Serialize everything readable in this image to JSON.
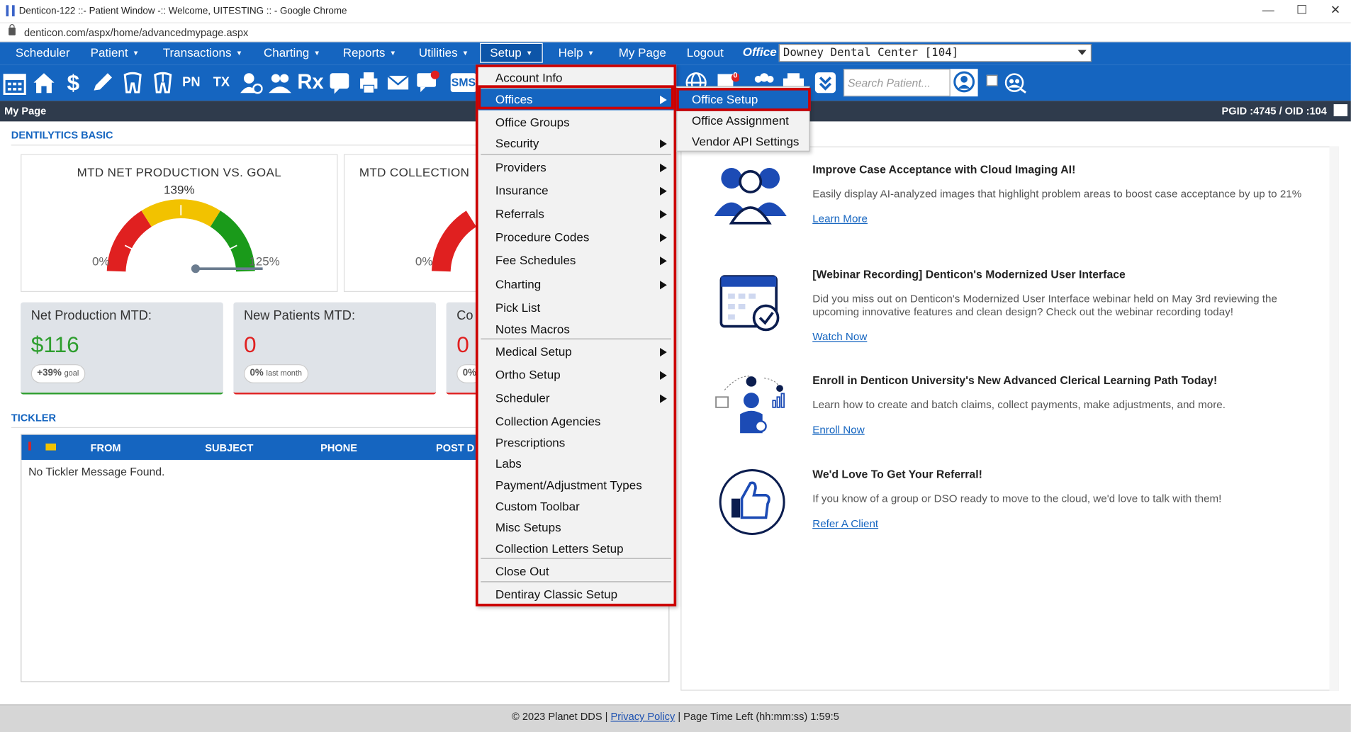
{
  "browser": {
    "title": "Denticon-122 ::- Patient Window -:: Welcome, UITESTING :: - Google Chrome",
    "url": "denticon.com/aspx/home/advancedmypage.aspx"
  },
  "nav": {
    "items": [
      "Scheduler",
      "Patient",
      "Transactions",
      "Charting",
      "Reports",
      "Utilities",
      "Setup",
      "Help",
      "My Page",
      "Logout"
    ],
    "office_label": "Office",
    "office_value": "Downey Dental Center [104]"
  },
  "toolbar": {
    "search_placeholder": "Search Patient...",
    "sms_label": "SMS",
    "pn_label": "PN",
    "tx_label": "TX",
    "rx_label": "Rx",
    "badge_count": "0"
  },
  "pagebar": {
    "title": "My Page",
    "ids": "PGID :4745  /  OID :104"
  },
  "dentilytics": {
    "title": "DENTILYTICS BASIC",
    "gauge1": {
      "title": "MTD NET PRODUCTION VS. GOAL",
      "value": "139%",
      "min": "0%",
      "max": "125%",
      "level": 1.0
    },
    "gauge2": {
      "title": "MTD COLLECTION",
      "min": "0%"
    },
    "stats": [
      {
        "label": "Net Production MTD:",
        "value": "$116",
        "badge": "+39%",
        "badge_note": "goal",
        "color": "#2e9e2e"
      },
      {
        "label": "New Patients MTD:",
        "value": "0",
        "badge": "0%",
        "badge_note": "last month",
        "color": "#e02020"
      },
      {
        "label": "Co",
        "value": "0",
        "badge": "0%",
        "badge_note": "",
        "color": "#e02020"
      }
    ]
  },
  "tickler": {
    "title": "TICKLER",
    "columns": [
      "FROM",
      "SUBJECT",
      "PHONE",
      "POST D"
    ],
    "empty": "No Tickler Message Found."
  },
  "news": [
    {
      "title": "Improve Case Acceptance with Cloud Imaging AI!",
      "desc": "Easily display AI-analyzed images that highlight problem areas to boost case acceptance by up to 21%",
      "link": "Learn More"
    },
    {
      "title": "[Webinar Recording] Denticon's Modernized User Interface",
      "desc": "Did you miss out on Denticon's Modernized User Interface webinar held on May 3rd reviewing the upcoming innovative features and clean design? Check out the webinar recording today!",
      "link": "Watch Now"
    },
    {
      "title": "Enroll in Denticon University's New Advanced Clerical Learning Path Today!",
      "desc": "Learn how to create and batch claims, collect payments, make adjustments, and more.",
      "link": "Enroll Now"
    },
    {
      "title": "We'd Love To Get Your Referral!",
      "desc": "If you know of a group or DSO ready to move to the cloud, we'd love to talk with them!",
      "link": "Refer A Client"
    }
  ],
  "setup_menu": [
    "Account Info",
    "Offices",
    "Office Groups",
    "Security",
    "Providers",
    "Insurance",
    "Referrals",
    "Procedure Codes",
    "Fee Schedules",
    "Charting",
    "Pick List",
    "Notes Macros",
    "Medical Setup",
    "Ortho Setup",
    "Scheduler",
    "Collection Agencies",
    "Prescriptions",
    "Labs",
    "Payment/Adjustment Types",
    "Custom Toolbar",
    "Misc Setups",
    "Collection Letters Setup",
    "Close Out",
    "Dentiray Classic Setup"
  ],
  "offices_submenu": [
    "Office Setup",
    "Office Assignment",
    "Vendor API Settings"
  ],
  "footer": {
    "copyright": "© 2023 Planet DDS |",
    "privacy": "Privacy Policy",
    "time_left": "|  Page Time Left (hh:mm:ss) 1:59:5"
  },
  "colors": {
    "brand": "#1565c0",
    "highlight": "#cc0000"
  }
}
